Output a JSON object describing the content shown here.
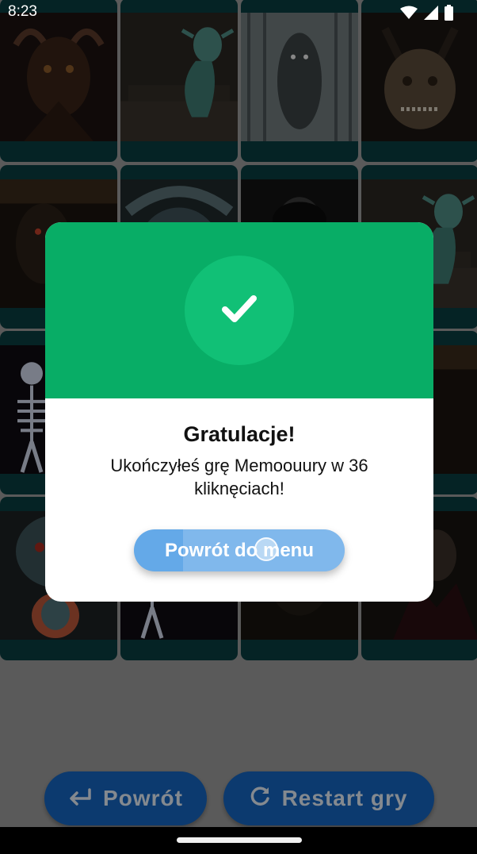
{
  "status_bar": {
    "time": "8:23",
    "icons": [
      "wifi-icon",
      "cellular-signal-icon",
      "battery-icon"
    ]
  },
  "grid": {
    "columns": 4,
    "rows": 4,
    "cards": [
      {
        "art": "demon-ram"
      },
      {
        "art": "goblin-stairs"
      },
      {
        "art": "fog-ghost"
      },
      {
        "art": "werewolf-mask"
      },
      {
        "art": "dark-beast"
      },
      {
        "art": "ogre-face"
      },
      {
        "art": "pale-man"
      },
      {
        "art": "goblin-stairs"
      },
      {
        "art": "skeleton"
      },
      {
        "art": "hidden"
      },
      {
        "art": "hidden"
      },
      {
        "art": "dark-beast"
      },
      {
        "art": "ogre-girl"
      },
      {
        "art": "skeleton"
      },
      {
        "art": "hidden"
      },
      {
        "art": "vampire"
      }
    ],
    "card_color": "#0a3d40"
  },
  "dialog": {
    "title": "Gratulacje!",
    "message": "Ukończyłeś grę Memoouury w 36 kliknęciach!",
    "button_label": "Powrót do menu",
    "header_color": "#08ad66",
    "icon": "checkmark-icon"
  },
  "bottom_bar": {
    "back_label": "Powrót",
    "back_icon": "return-arrow-icon",
    "restart_label": "Restart gry",
    "restart_icon": "refresh-icon",
    "button_color": "#1565c0"
  }
}
